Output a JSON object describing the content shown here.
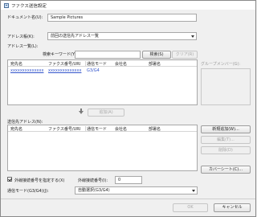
{
  "window": {
    "title": "ファクス送信設定"
  },
  "document": {
    "label": "ドキュメント名(U):",
    "value": "Sample Pictures"
  },
  "address_book": {
    "label": "アドレス帳(K):",
    "selected": "前回の送信先アドレス一覧"
  },
  "address_list": {
    "label": "アドレス一覧(L):",
    "search_label": "検索キーワード(Y):",
    "search_value": "",
    "search_button": "検索(S)",
    "clear_button": "クリア(R)",
    "columns": [
      "宛先名",
      "ファクス番号/URI",
      "通信モード",
      "会社名",
      "部署名"
    ],
    "rows": [
      {
        "name": "xxxxxxxxxxxxxx",
        "number": "xxxxxxxxxxxxxx",
        "mode": "G3/G4",
        "company": "",
        "dept": ""
      }
    ]
  },
  "group_members": {
    "label": "グループメンバー(G):"
  },
  "add_button": "追加(A)",
  "recipients": {
    "label": "送信先アドレス(N):",
    "columns": [
      "宛先名",
      "ファクス番号/URI",
      "通信モード",
      "会社名",
      "部署名"
    ],
    "new_button": "新規追加(W)...",
    "edit_button": "編集(T)...",
    "delete_button": "削除(D)",
    "cover_button": "カバーシート(C)..."
  },
  "outside_line": {
    "checkbox_label": "外線接続番号を指定する(X)",
    "checked": true,
    "number_label": "外線接続番号(I):",
    "number_value": "0"
  },
  "comm_mode": {
    "label": "通信モード(G3/G4)(J):",
    "selected": "自動選択(G3/G4)"
  },
  "footer": {
    "ok_button": "OK",
    "cancel_button": "キャンセル"
  }
}
